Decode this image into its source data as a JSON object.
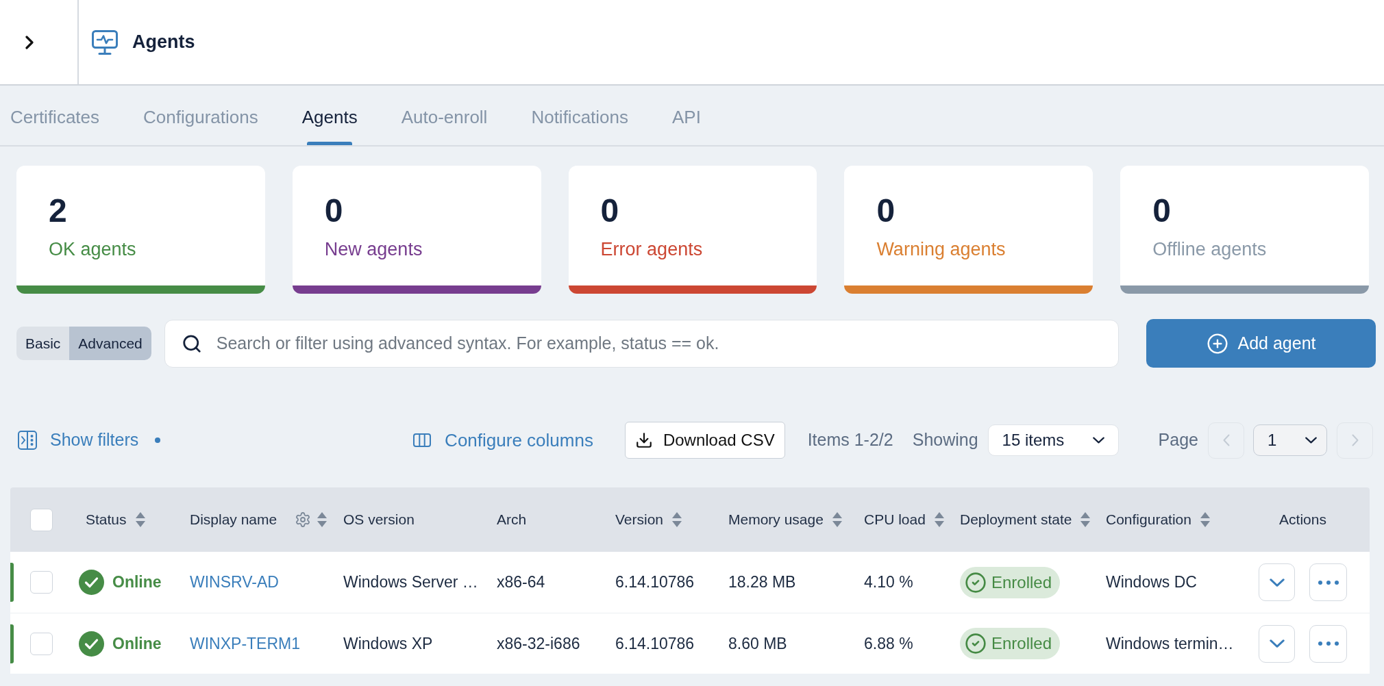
{
  "header": {
    "title": "Agents"
  },
  "tabs": [
    {
      "label": "Certificates",
      "selected": false
    },
    {
      "label": "Configurations",
      "selected": false
    },
    {
      "label": "Agents",
      "selected": true
    },
    {
      "label": "Auto-enroll",
      "selected": false
    },
    {
      "label": "Notifications",
      "selected": false
    },
    {
      "label": "API",
      "selected": false
    }
  ],
  "stats": [
    {
      "value": "2",
      "label": "OK agents",
      "color": "#468c46"
    },
    {
      "value": "0",
      "label": "New agents",
      "color": "#773d8f"
    },
    {
      "value": "0",
      "label": "Error agents",
      "color": "#cc4733"
    },
    {
      "value": "0",
      "label": "Warning agents",
      "color": "#da7f31"
    },
    {
      "value": "0",
      "label": "Offline agents",
      "color": "#8a99a8"
    }
  ],
  "search": {
    "modes": [
      {
        "label": "Basic",
        "selected": false
      },
      {
        "label": "Advanced",
        "selected": true
      }
    ],
    "placeholder": "Search or filter using advanced syntax. For example, status == ok."
  },
  "add_button": {
    "label": "Add agent"
  },
  "toolbar": {
    "show_filters": {
      "label": "Show filters",
      "indicator": true
    },
    "configure_columns": {
      "label": "Configure columns"
    },
    "download": {
      "label": "Download CSV"
    },
    "items": "Items 1-2/2",
    "showing": {
      "label": "Showing",
      "value": "15 items"
    },
    "page": {
      "label": "Page",
      "value": "1",
      "prev_disabled": true,
      "next_disabled": true
    }
  },
  "table": {
    "select_all": {
      "checked": false
    },
    "columns": [
      {
        "label": "Status",
        "kind": "sortable"
      },
      {
        "label": "Display name",
        "kind": "configurable"
      },
      {
        "label": "OS version",
        "kind": "plain"
      },
      {
        "label": "Arch",
        "kind": "plain"
      },
      {
        "label": "Version",
        "kind": "sortable"
      },
      {
        "label": "Memory usage",
        "kind": "sortable"
      },
      {
        "label": "CPU load",
        "kind": "sortable"
      },
      {
        "label": "Deployment state",
        "kind": "sortable"
      },
      {
        "label": "Configuration",
        "kind": "sortable"
      },
      {
        "label": "Actions",
        "kind": "actions"
      }
    ],
    "rows": [
      {
        "checked": false,
        "color": "#468c46",
        "status": "Online",
        "display_name": "WINSRV-AD",
        "os_version": "Windows Server …",
        "arch": "x86-64",
        "version": "6.14.10786",
        "memory_usage": "18.28 MB",
        "cpu_load": "4.10 %",
        "deployment_state": "Enrolled",
        "configuration": "Windows DC"
      },
      {
        "checked": false,
        "color": "#468c46",
        "status": "Online",
        "display_name": "WINXP-TERM1",
        "os_version": "Windows XP",
        "arch": "x86-32-i686",
        "version": "6.14.10786",
        "memory_usage": "8.60 MB",
        "cpu_load": "6.88 %",
        "deployment_state": "Enrolled",
        "configuration": "Windows termin…"
      }
    ]
  }
}
